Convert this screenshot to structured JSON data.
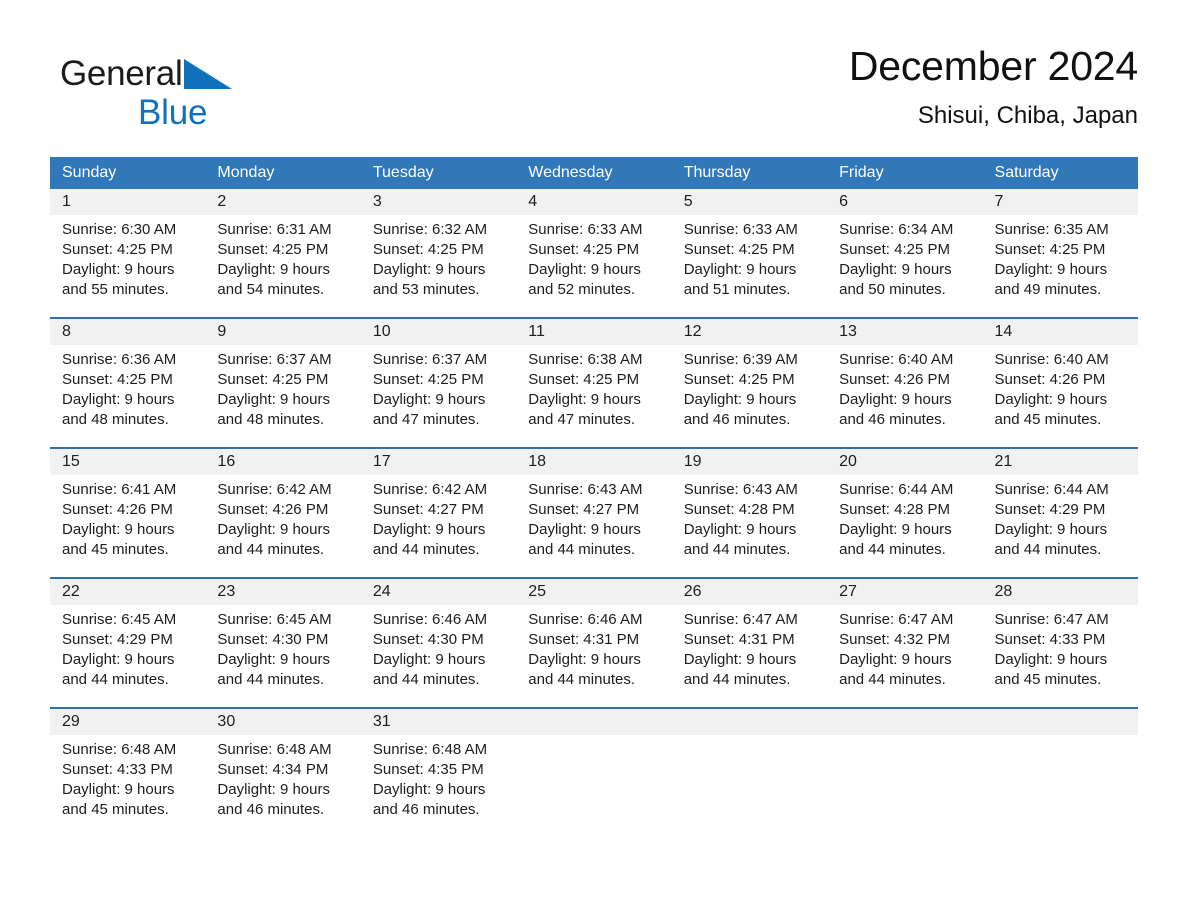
{
  "brand": {
    "name_part1": "General",
    "name_part2": "Blue",
    "triangle_icon": "brand-triangle-icon",
    "accent_color": "#1271bd"
  },
  "header": {
    "title": "December 2024",
    "subtitle": "Shisui, Chiba, Japan"
  },
  "colors": {
    "header_blue": "#3178b9",
    "row_divider_blue": "#2f6fab",
    "daynum_band_gray": "#f1f1f1",
    "text": "#1d1d1d"
  },
  "weekdays": [
    "Sunday",
    "Monday",
    "Tuesday",
    "Wednesday",
    "Thursday",
    "Friday",
    "Saturday"
  ],
  "weeks": [
    [
      {
        "day": "1",
        "lines": [
          "Sunrise: 6:30 AM",
          "Sunset: 4:25 PM",
          "Daylight: 9 hours",
          "and 55 minutes."
        ]
      },
      {
        "day": "2",
        "lines": [
          "Sunrise: 6:31 AM",
          "Sunset: 4:25 PM",
          "Daylight: 9 hours",
          "and 54 minutes."
        ]
      },
      {
        "day": "3",
        "lines": [
          "Sunrise: 6:32 AM",
          "Sunset: 4:25 PM",
          "Daylight: 9 hours",
          "and 53 minutes."
        ]
      },
      {
        "day": "4",
        "lines": [
          "Sunrise: 6:33 AM",
          "Sunset: 4:25 PM",
          "Daylight: 9 hours",
          "and 52 minutes."
        ]
      },
      {
        "day": "5",
        "lines": [
          "Sunrise: 6:33 AM",
          "Sunset: 4:25 PM",
          "Daylight: 9 hours",
          "and 51 minutes."
        ]
      },
      {
        "day": "6",
        "lines": [
          "Sunrise: 6:34 AM",
          "Sunset: 4:25 PM",
          "Daylight: 9 hours",
          "and 50 minutes."
        ]
      },
      {
        "day": "7",
        "lines": [
          "Sunrise: 6:35 AM",
          "Sunset: 4:25 PM",
          "Daylight: 9 hours",
          "and 49 minutes."
        ]
      }
    ],
    [
      {
        "day": "8",
        "lines": [
          "Sunrise: 6:36 AM",
          "Sunset: 4:25 PM",
          "Daylight: 9 hours",
          "and 48 minutes."
        ]
      },
      {
        "day": "9",
        "lines": [
          "Sunrise: 6:37 AM",
          "Sunset: 4:25 PM",
          "Daylight: 9 hours",
          "and 48 minutes."
        ]
      },
      {
        "day": "10",
        "lines": [
          "Sunrise: 6:37 AM",
          "Sunset: 4:25 PM",
          "Daylight: 9 hours",
          "and 47 minutes."
        ]
      },
      {
        "day": "11",
        "lines": [
          "Sunrise: 6:38 AM",
          "Sunset: 4:25 PM",
          "Daylight: 9 hours",
          "and 47 minutes."
        ]
      },
      {
        "day": "12",
        "lines": [
          "Sunrise: 6:39 AM",
          "Sunset: 4:25 PM",
          "Daylight: 9 hours",
          "and 46 minutes."
        ]
      },
      {
        "day": "13",
        "lines": [
          "Sunrise: 6:40 AM",
          "Sunset: 4:26 PM",
          "Daylight: 9 hours",
          "and 46 minutes."
        ]
      },
      {
        "day": "14",
        "lines": [
          "Sunrise: 6:40 AM",
          "Sunset: 4:26 PM",
          "Daylight: 9 hours",
          "and 45 minutes."
        ]
      }
    ],
    [
      {
        "day": "15",
        "lines": [
          "Sunrise: 6:41 AM",
          "Sunset: 4:26 PM",
          "Daylight: 9 hours",
          "and 45 minutes."
        ]
      },
      {
        "day": "16",
        "lines": [
          "Sunrise: 6:42 AM",
          "Sunset: 4:26 PM",
          "Daylight: 9 hours",
          "and 44 minutes."
        ]
      },
      {
        "day": "17",
        "lines": [
          "Sunrise: 6:42 AM",
          "Sunset: 4:27 PM",
          "Daylight: 9 hours",
          "and 44 minutes."
        ]
      },
      {
        "day": "18",
        "lines": [
          "Sunrise: 6:43 AM",
          "Sunset: 4:27 PM",
          "Daylight: 9 hours",
          "and 44 minutes."
        ]
      },
      {
        "day": "19",
        "lines": [
          "Sunrise: 6:43 AM",
          "Sunset: 4:28 PM",
          "Daylight: 9 hours",
          "and 44 minutes."
        ]
      },
      {
        "day": "20",
        "lines": [
          "Sunrise: 6:44 AM",
          "Sunset: 4:28 PM",
          "Daylight: 9 hours",
          "and 44 minutes."
        ]
      },
      {
        "day": "21",
        "lines": [
          "Sunrise: 6:44 AM",
          "Sunset: 4:29 PM",
          "Daylight: 9 hours",
          "and 44 minutes."
        ]
      }
    ],
    [
      {
        "day": "22",
        "lines": [
          "Sunrise: 6:45 AM",
          "Sunset: 4:29 PM",
          "Daylight: 9 hours",
          "and 44 minutes."
        ]
      },
      {
        "day": "23",
        "lines": [
          "Sunrise: 6:45 AM",
          "Sunset: 4:30 PM",
          "Daylight: 9 hours",
          "and 44 minutes."
        ]
      },
      {
        "day": "24",
        "lines": [
          "Sunrise: 6:46 AM",
          "Sunset: 4:30 PM",
          "Daylight: 9 hours",
          "and 44 minutes."
        ]
      },
      {
        "day": "25",
        "lines": [
          "Sunrise: 6:46 AM",
          "Sunset: 4:31 PM",
          "Daylight: 9 hours",
          "and 44 minutes."
        ]
      },
      {
        "day": "26",
        "lines": [
          "Sunrise: 6:47 AM",
          "Sunset: 4:31 PM",
          "Daylight: 9 hours",
          "and 44 minutes."
        ]
      },
      {
        "day": "27",
        "lines": [
          "Sunrise: 6:47 AM",
          "Sunset: 4:32 PM",
          "Daylight: 9 hours",
          "and 44 minutes."
        ]
      },
      {
        "day": "28",
        "lines": [
          "Sunrise: 6:47 AM",
          "Sunset: 4:33 PM",
          "Daylight: 9 hours",
          "and 45 minutes."
        ]
      }
    ],
    [
      {
        "day": "29",
        "lines": [
          "Sunrise: 6:48 AM",
          "Sunset: 4:33 PM",
          "Daylight: 9 hours",
          "and 45 minutes."
        ]
      },
      {
        "day": "30",
        "lines": [
          "Sunrise: 6:48 AM",
          "Sunset: 4:34 PM",
          "Daylight: 9 hours",
          "and 46 minutes."
        ]
      },
      {
        "day": "31",
        "lines": [
          "Sunrise: 6:48 AM",
          "Sunset: 4:35 PM",
          "Daylight: 9 hours",
          "and 46 minutes."
        ]
      },
      {
        "day": "",
        "lines": []
      },
      {
        "day": "",
        "lines": []
      },
      {
        "day": "",
        "lines": []
      },
      {
        "day": "",
        "lines": []
      }
    ]
  ]
}
